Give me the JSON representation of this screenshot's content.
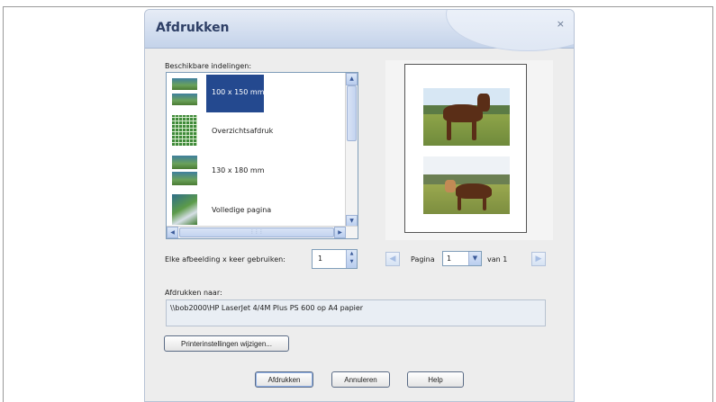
{
  "dialog": {
    "title": "Afdrukken",
    "close_symbol": "×"
  },
  "layouts": {
    "label": "Beschikbare indelingen:",
    "items": [
      {
        "label": "100 x 150 mm",
        "selected": true,
        "icon": "two-photos-thumbnail-icon"
      },
      {
        "label": "Overzichtsafdruk",
        "selected": false,
        "icon": "contact-sheet-thumbnail-icon"
      },
      {
        "label": "130 x 180 mm",
        "selected": false,
        "icon": "two-photos-thumbnail-icon"
      },
      {
        "label": "Volledige pagina",
        "selected": false,
        "icon": "full-page-thumbnail-icon"
      }
    ]
  },
  "copies": {
    "label": "Elke afbeelding x keer gebruiken:",
    "value": "1"
  },
  "pagination": {
    "label": "Pagina",
    "current": "1",
    "of_label": "van 1"
  },
  "print_to": {
    "label": "Afdrukken naar:",
    "printer": "\\\\bob2000\\HP LaserJet 4/4M Plus PS 600 op A4 papier"
  },
  "buttons": {
    "printer_settings": "Printerinstellingen wijzigen...",
    "print": "Afdrukken",
    "cancel": "Annuleren",
    "help": "Help"
  },
  "colors": {
    "selection": "#24498f",
    "title_text": "#2e3f66"
  }
}
